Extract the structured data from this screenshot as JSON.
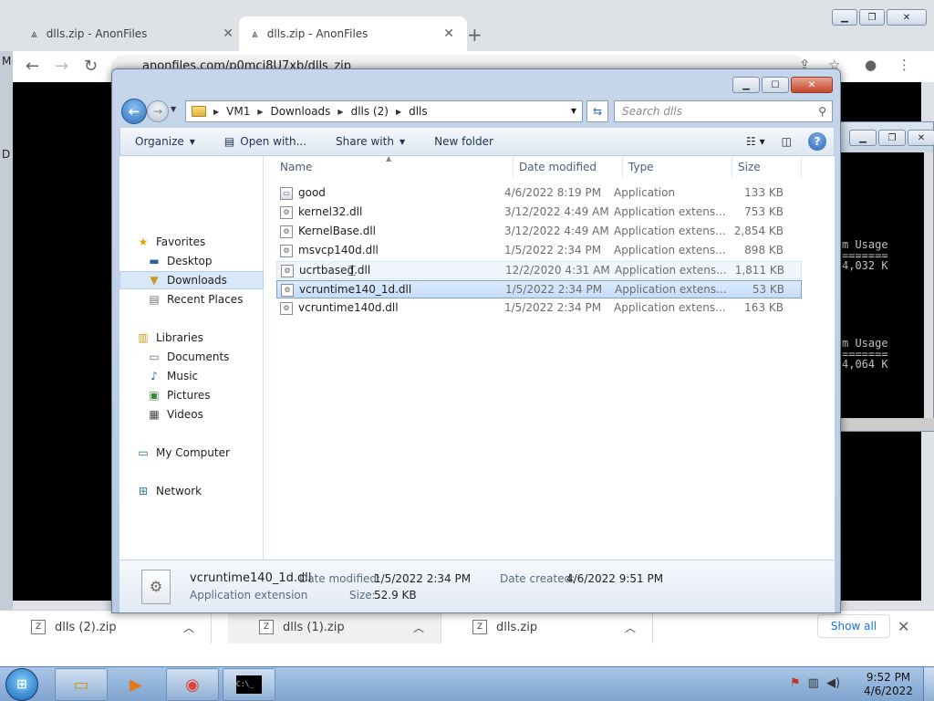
{
  "browser": {
    "tabs": [
      {
        "label": "dlls.zip - AnonFiles",
        "active": false
      },
      {
        "label": "dlls.zip - AnonFiles",
        "active": true
      }
    ],
    "url": "anonfiles.com/p0mci8U7xb/dlls_zip",
    "left_edge_letters": [
      "M",
      "D"
    ],
    "downloads": [
      {
        "name": "dlls (2).zip"
      },
      {
        "name": "dlls (1).zip"
      },
      {
        "name": "dlls.zip"
      }
    ],
    "show_all_label": "Show all"
  },
  "console": {
    "lines_a": [
      "m Usage",
      "=======",
      "4,032 K"
    ],
    "lines_b": [
      "m Usage",
      "=======",
      "4,064 K"
    ]
  },
  "explorer": {
    "breadcrumbs": [
      "VM1",
      "Downloads",
      "dlls (2)",
      "dlls"
    ],
    "search_placeholder": "Search dlls",
    "commands": {
      "organize": "Organize",
      "open_with": "Open with...",
      "share_with": "Share with",
      "new_folder": "New folder"
    },
    "nav": {
      "favorites": "Favorites",
      "desktop": "Desktop",
      "downloads": "Downloads",
      "recent_places": "Recent Places",
      "libraries": "Libraries",
      "documents": "Documents",
      "music": "Music",
      "pictures": "Pictures",
      "videos": "Videos",
      "my_computer": "My Computer",
      "network": "Network"
    },
    "columns": {
      "name": "Name",
      "date": "Date modified",
      "type": "Type",
      "size": "Size"
    },
    "files": [
      {
        "name": "good",
        "date": "4/6/2022 8:19 PM",
        "type": "Application",
        "size": "133 KB"
      },
      {
        "name": "kernel32.dll",
        "date": "3/12/2022 4:49 AM",
        "type": "Application extens...",
        "size": "753 KB"
      },
      {
        "name": "KernelBase.dll",
        "date": "3/12/2022 4:49 AM",
        "type": "Application extens...",
        "size": "2,854 KB"
      },
      {
        "name": "msvcp140d.dll",
        "date": "1/5/2022 2:34 PM",
        "type": "Application extens...",
        "size": "898 KB"
      },
      {
        "name": "ucrtbased.dll",
        "date": "12/2/2020 4:31 AM",
        "type": "Application extens...",
        "size": "1,811 KB"
      },
      {
        "name": "vcruntime140_1d.dll",
        "date": "1/5/2022 2:34 PM",
        "type": "Application extens...",
        "size": "53 KB"
      },
      {
        "name": "vcruntime140d.dll",
        "date": "1/5/2022 2:34 PM",
        "type": "Application extens...",
        "size": "163 KB"
      }
    ],
    "details": {
      "filename": "vcruntime140_1d.dll",
      "type": "Application extension",
      "date_modified_label": "Date modified:",
      "date_modified": "1/5/2022 2:34 PM",
      "date_created_label": "Date created:",
      "date_created": "4/6/2022 9:51 PM",
      "size_label": "Size:",
      "size": "52.9 KB"
    }
  },
  "taskbar": {
    "time": "9:52 PM",
    "date": "4/6/2022"
  }
}
